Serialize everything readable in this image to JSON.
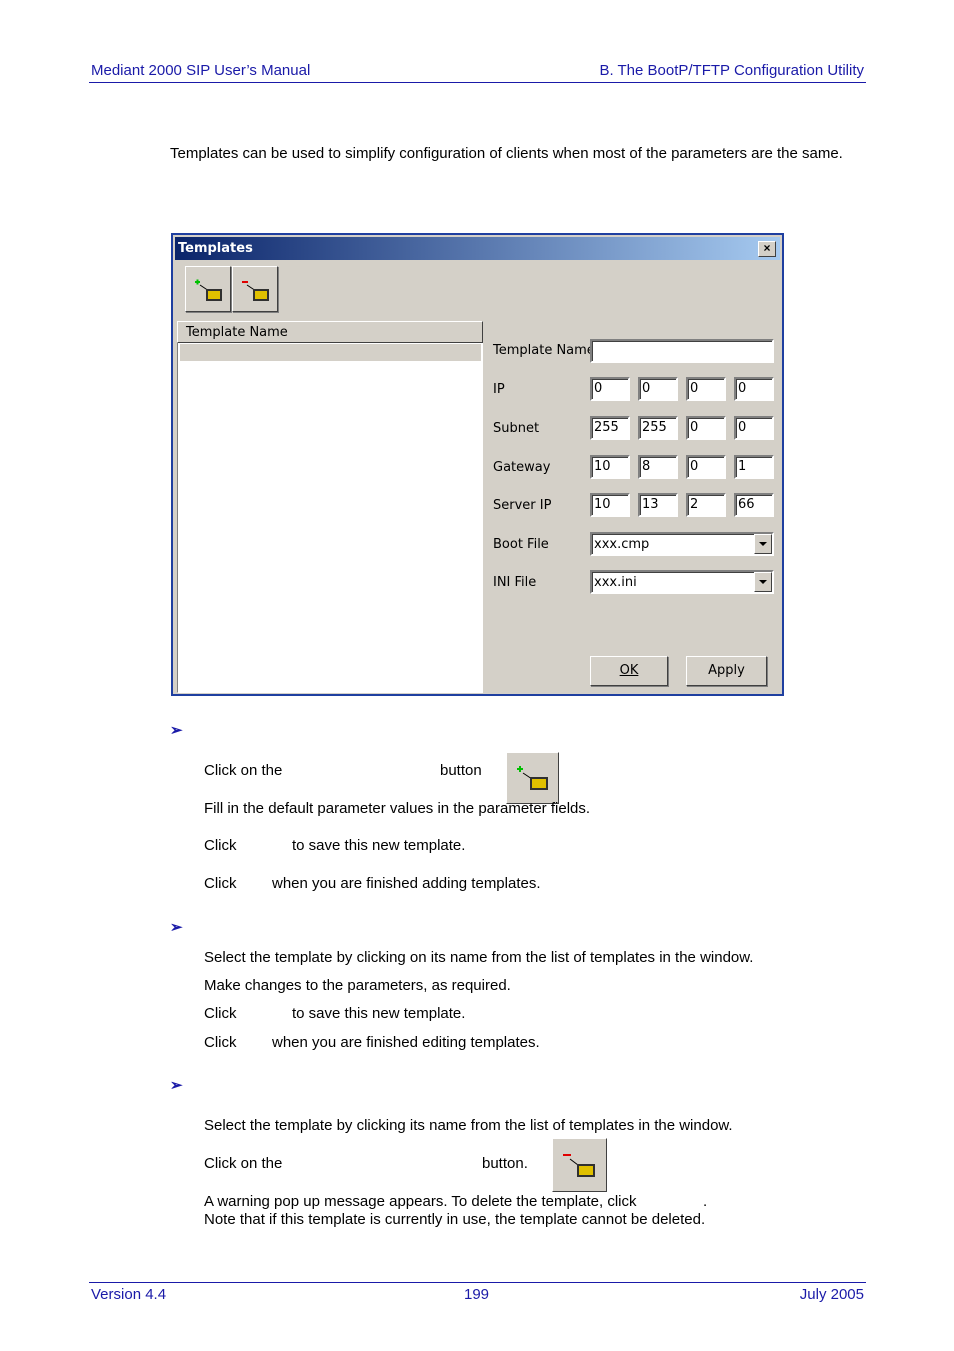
{
  "header": {
    "left": "Mediant 2000 SIP User’s Manual",
    "right": "B. The BootP/TFTP Configuration Utility"
  },
  "intro": "Templates can be used to simplify configuration of clients when most of the parameters are the same.",
  "dialog": {
    "title": "Templates",
    "close": "×",
    "list_header": "Template Name",
    "labels": {
      "template_name": "Template Name",
      "ip": "IP",
      "subnet": "Subnet",
      "gateway": "Gateway",
      "server_ip": "Server IP",
      "boot_file": "Boot File",
      "ini_file": "INI File"
    },
    "values": {
      "template_name": "",
      "ip": [
        "0",
        "0",
        "0",
        "0"
      ],
      "subnet": [
        "255",
        "255",
        "0",
        "0"
      ],
      "gateway": [
        "10",
        "8",
        "0",
        "1"
      ],
      "server_ip": [
        "10",
        "13",
        "2",
        "66"
      ],
      "boot_file": "xxx.cmp",
      "ini_file": "xxx.ini"
    },
    "ok_label": "OK",
    "apply_label": "Apply"
  },
  "sections": [
    {
      "steps": [
        {
          "a": "Click on the",
          "b": "button"
        },
        {
          "a": "Fill in the default parameter values in the parameter fields."
        },
        {
          "a": "Click",
          "b": "to save this new template."
        },
        {
          "a": "Click",
          "b": "when you are finished adding templates."
        }
      ]
    },
    {
      "steps": [
        {
          "a": "Select the template by clicking on its name from the list of templates in the window."
        },
        {
          "a": "Make changes to the parameters, as required."
        },
        {
          "a": "Click",
          "b": "to save this new template."
        },
        {
          "a": "Click",
          "b": "when you are finished editing templates."
        }
      ]
    },
    {
      "steps": [
        {
          "a": "Select the template by clicking its name from the list of templates in the window."
        },
        {
          "a": "Click on the",
          "b": "button."
        },
        {
          "a": "A warning pop up message appears. To delete the template, click",
          "b": "."
        },
        {
          "a": "Note that if this template is currently in use, the template cannot be deleted."
        }
      ]
    }
  ],
  "bullet": "➢",
  "footer": {
    "version": "Version 4.4",
    "page": "199",
    "date": "July 2005"
  }
}
